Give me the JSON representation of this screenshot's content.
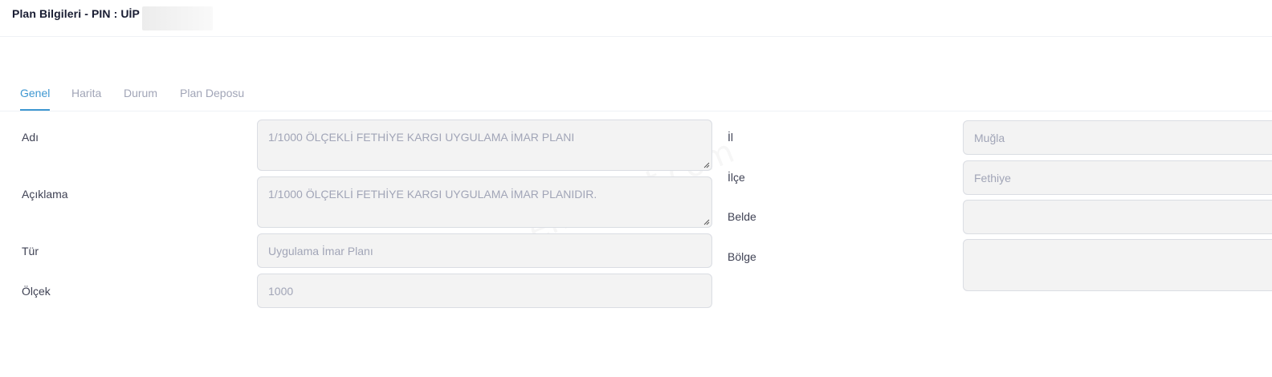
{
  "header": {
    "title": "Plan Bilgileri - PIN : UİP"
  },
  "tabs": [
    {
      "label": "Genel",
      "active": true
    },
    {
      "label": "Harita",
      "active": false
    },
    {
      "label": "Durum",
      "active": false
    },
    {
      "label": "Plan Deposu",
      "active": false
    }
  ],
  "form_left": {
    "adi": {
      "label": "Adı",
      "value": "1/1000 ÖLÇEKLİ FETHİYE KARGI UYGULAMA İMAR PLANI"
    },
    "aciklama": {
      "label": "Açıklama",
      "value": "1/1000 ÖLÇEKLİ FETHİYE KARGI UYGULAMA İMAR PLANIDIR."
    },
    "tur": {
      "label": "Tür",
      "value": "Uygulama İmar Planı"
    },
    "olcek": {
      "label": "Ölçek",
      "value": "1000"
    }
  },
  "form_right": {
    "il": {
      "label": "İl",
      "value": "Muğla"
    },
    "ilce": {
      "label": "İlçe",
      "value": "Fethiye"
    },
    "belde": {
      "label": "Belde",
      "value": ""
    },
    "bolge": {
      "label": "Bölge",
      "value": ""
    }
  },
  "colors": {
    "accent": "#3e97d1",
    "field_bg": "#f3f3f3",
    "field_text": "#a1a5b7"
  }
}
